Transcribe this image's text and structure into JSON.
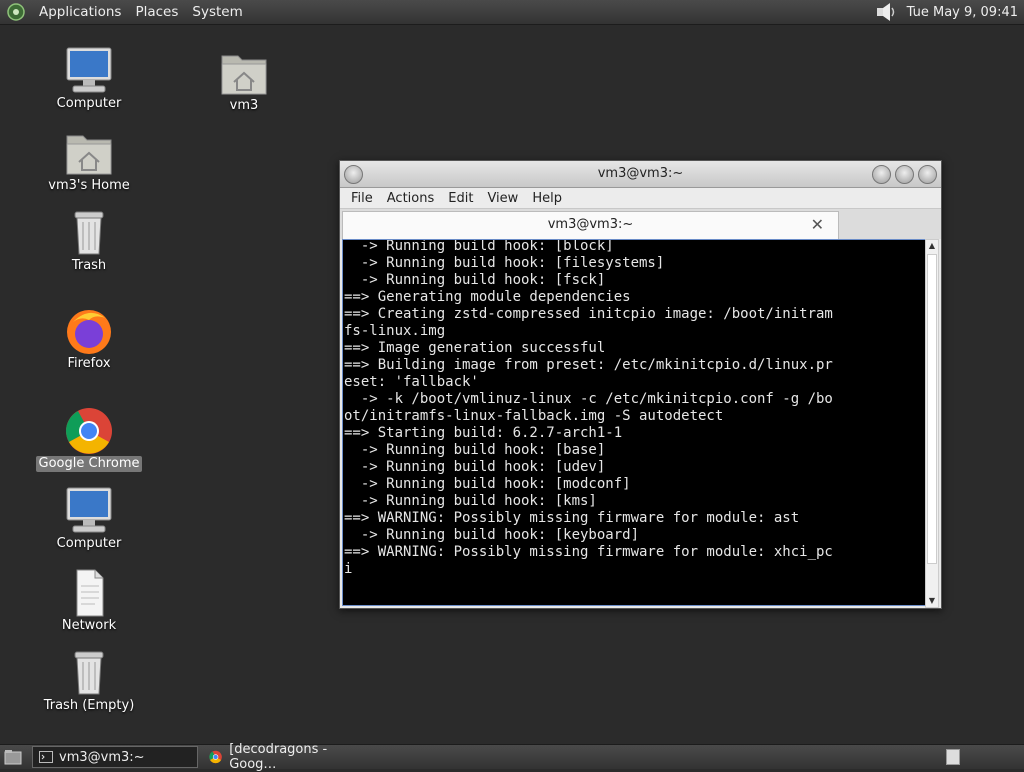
{
  "top_panel": {
    "menus": [
      "Applications",
      "Places",
      "System"
    ],
    "clock": "Tue May  9, 09:41",
    "icons": {
      "logo": "gnome-foot-icon",
      "volume": "speaker-icon"
    }
  },
  "desktop_icons": [
    {
      "label": "Computer",
      "icon": "computer-icon"
    },
    {
      "label": "vm3's Home",
      "icon": "home-folder-icon"
    },
    {
      "label": "Trash",
      "icon": "trash-icon"
    },
    {
      "label": "Firefox",
      "icon": "firefox-icon"
    },
    {
      "label": "Google Chrome",
      "icon": "chrome-icon"
    },
    {
      "label": "Computer",
      "icon": "computer-icon"
    },
    {
      "label": "Network",
      "icon": "document-icon"
    },
    {
      "label": "Trash (Empty)",
      "icon": "trash-icon"
    },
    {
      "label": "vm3",
      "icon": "home-folder-icon"
    }
  ],
  "window": {
    "title": "vm3@vm3:~",
    "menu": [
      "File",
      "Actions",
      "Edit",
      "View",
      "Help"
    ],
    "tab_title": "vm3@vm3:~",
    "terminal_lines": [
      "  -> Running build hook: [block]",
      "  -> Running build hook: [filesystems]",
      "  -> Running build hook: [fsck]",
      "==> Generating module dependencies",
      "==> Creating zstd-compressed initcpio image: /boot/initram",
      "fs-linux.img",
      "==> Image generation successful",
      "==> Building image from preset: /etc/mkinitcpio.d/linux.pr",
      "eset: 'fallback'",
      "  -> -k /boot/vmlinuz-linux -c /etc/mkinitcpio.conf -g /bo",
      "ot/initramfs-linux-fallback.img -S autodetect",
      "==> Starting build: 6.2.7-arch1-1",
      "  -> Running build hook: [base]",
      "  -> Running build hook: [udev]",
      "  -> Running build hook: [modconf]",
      "  -> Running build hook: [kms]",
      "==> WARNING: Possibly missing firmware for module: ast",
      "  -> Running build hook: [keyboard]",
      "==> WARNING: Possibly missing firmware for module: xhci_pc",
      "i"
    ]
  },
  "taskbar": {
    "tasks": [
      {
        "label": "vm3@vm3:~",
        "icon": "terminal-icon",
        "active": true
      },
      {
        "label": "[decodragons - Goog…",
        "icon": "chrome-icon",
        "active": false
      }
    ]
  }
}
